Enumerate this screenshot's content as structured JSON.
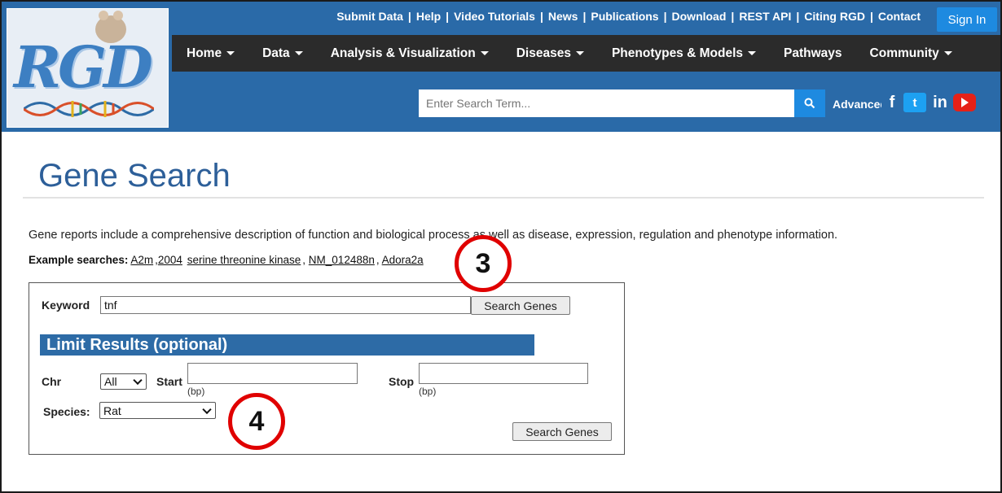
{
  "header": {
    "logo_text": "RGD",
    "top_links": [
      "Submit Data",
      "Help",
      "Video Tutorials",
      "News",
      "Publications",
      "Download",
      "REST API",
      "Citing RGD",
      "Contact"
    ],
    "sign_in": "Sign In",
    "nav": [
      {
        "label": "Home",
        "dropdown": true
      },
      {
        "label": "Data",
        "dropdown": true
      },
      {
        "label": "Analysis & Visualization",
        "dropdown": true
      },
      {
        "label": "Diseases",
        "dropdown": true
      },
      {
        "label": "Phenotypes & Models",
        "dropdown": true
      },
      {
        "label": "Pathways",
        "dropdown": false
      },
      {
        "label": "Community",
        "dropdown": true
      }
    ],
    "search_placeholder": "Enter Search Term...",
    "advanced_label": "Advanced Search",
    "social": {
      "facebook": "f",
      "twitter": "t",
      "linkedin": "in"
    },
    "colors": {
      "header_bg": "#2a6aa8",
      "nav_bg": "#2b2b2b",
      "accent": "#1e8ae0"
    }
  },
  "main": {
    "title": "Gene Search",
    "description": "Gene reports include a comprehensive description of function and biological process as well as disease, expression, regulation and phenotype information.",
    "examples_label": "Example searches:",
    "examples": [
      "A2m",
      "2004",
      "serine threonine kinase",
      "NM_012488n",
      "Adora2a"
    ],
    "form": {
      "keyword_label": "Keyword",
      "keyword_value": "tnf",
      "search_button": "Search Genes",
      "limit_heading": "Limit Results (optional)",
      "chr_label": "Chr",
      "chr_value": "All",
      "start_label": "Start",
      "start_unit": "(bp)",
      "stop_label": "Stop",
      "stop_unit": "(bp)",
      "species_label": "Species:",
      "species_value": "Rat",
      "search_button_2": "Search Genes"
    }
  },
  "annotations": [
    {
      "number": "3",
      "color": "#e00000"
    },
    {
      "number": "4",
      "color": "#e00000"
    }
  ]
}
